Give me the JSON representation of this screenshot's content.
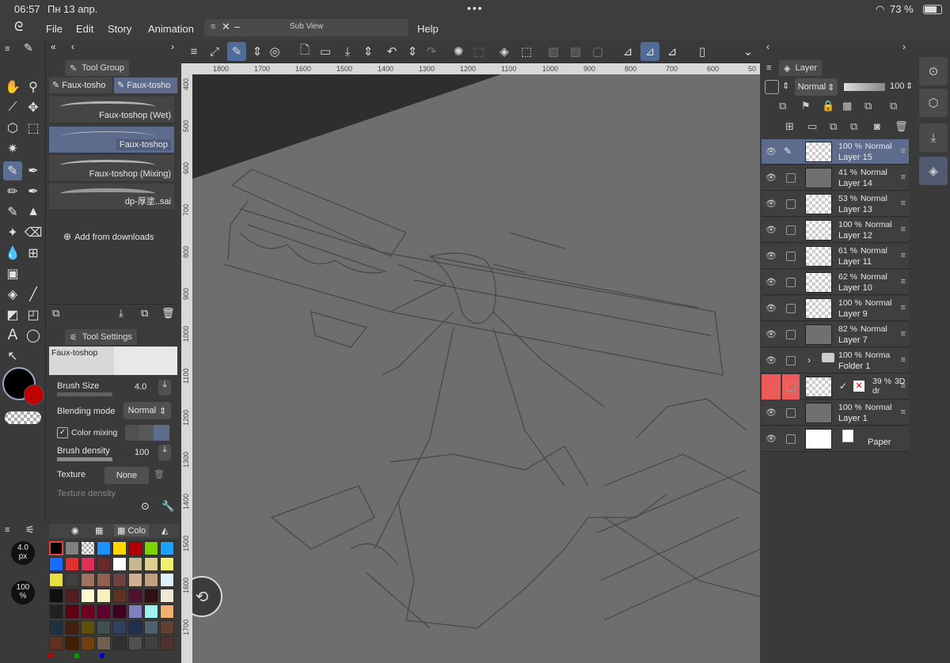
{
  "status": {
    "time": "06:57",
    "date": "Пн 13 апр.",
    "battery": "73 %"
  },
  "menu": {
    "file": "File",
    "edit": "Edit",
    "story": "Story",
    "animation": "Animation",
    "help": "Help",
    "subview": "Sub View"
  },
  "toolgroup": {
    "tab": "Tool Group",
    "subtabs": [
      "Faux-tosho",
      "Faux-tosho"
    ],
    "brushes": [
      "Faux-toshop (Wet)",
      "Faux-toshop",
      "Faux-toshop (Mixing)",
      "dp-厚塗..sai"
    ],
    "add_label": "Add from downloads"
  },
  "toolsettings": {
    "tab": "Tool Settings",
    "preset": "Faux-toshop",
    "brush_size_label": "Brush Size",
    "brush_size_value": "4.0",
    "blending_label": "Blending mode",
    "blending_value": "Normal",
    "color_mixing_label": "Color mixing",
    "density_label": "Brush density",
    "density_value": "100",
    "texture_label": "Texture",
    "texture_value": "None",
    "texture_density_label": "Texture density"
  },
  "bottom_left": {
    "size_value": "4.0",
    "size_unit": "px",
    "opacity_value": "100",
    "opacity_unit": "%",
    "color_tab": "Colo"
  },
  "ruler_top": [
    "1800",
    "1700",
    "1600",
    "1500",
    "1400",
    "1300",
    "1200",
    "1100",
    "1000",
    "900",
    "800",
    "700",
    "600",
    "50"
  ],
  "ruler_left": [
    "400",
    "500",
    "600",
    "700",
    "800",
    "900",
    "1000",
    "1100",
    "1200",
    "1300",
    "1400",
    "1500",
    "1600",
    "1700"
  ],
  "layerpanel": {
    "tab": "Layer",
    "blend": "Normal",
    "opacity": "100",
    "layers": [
      {
        "pct": "100 %",
        "mode": "Normal",
        "name": "Layer 15"
      },
      {
        "pct": "41 %",
        "mode": "Normal",
        "name": "Layer 14"
      },
      {
        "pct": "53 %",
        "mode": "Normal",
        "name": "Layer 13"
      },
      {
        "pct": "100 %",
        "mode": "Normal",
        "name": "Layer 12"
      },
      {
        "pct": "61 %",
        "mode": "Normal",
        "name": "Layer 11"
      },
      {
        "pct": "62 %",
        "mode": "Normal",
        "name": "Layer 10"
      },
      {
        "pct": "100 %",
        "mode": "Normal",
        "name": "Layer 9"
      },
      {
        "pct": "82 %",
        "mode": "Normal",
        "name": "Layer 7"
      },
      {
        "pct": "100 %",
        "mode": "Norma",
        "name": "Folder 1"
      },
      {
        "pct": "39 %",
        "mode": "3D dr",
        "name": ""
      },
      {
        "pct": "100 %",
        "mode": "Normal",
        "name": "Layer 1"
      },
      {
        "pct": "",
        "mode": "",
        "name": "Paper"
      }
    ]
  },
  "colors": {
    "accent": "#5d6c8c",
    "main_color": "#000000",
    "sub_color": "#c00000",
    "palette": [
      "#000000",
      "#808080",
      "checker",
      "#1e90ff",
      "#ffd700",
      "#b00000",
      "#7cd500",
      "#1ea0ff",
      "#1a6cff",
      "#e03030",
      "#e0305a",
      "#6a2a2a",
      "#ffffff",
      "#c8b890",
      "#e0d090",
      "#f0f070",
      "#e8e040",
      "#404040",
      "#a07060",
      "#906050",
      "#704040",
      "#d0b090",
      "#c0a080",
      "#e0f0ff",
      "#101010",
      "#502020",
      "#fff8d0",
      "#f8f0c0",
      "#603020",
      "#501030",
      "#301010",
      "#f0e8d8",
      "#202020",
      "#600010",
      "#700020",
      "#600030",
      "#400020",
      "#8080c0",
      "#a0f0f0",
      "#f0b070",
      "#203040",
      "#402010",
      "#605010",
      "#405050",
      "#304060",
      "#203050",
      "#506070",
      "#604030",
      "#603020",
      "#402000",
      "#704010",
      "#706050",
      "#303030",
      "#505050",
      "#404040",
      "#503030"
    ]
  }
}
